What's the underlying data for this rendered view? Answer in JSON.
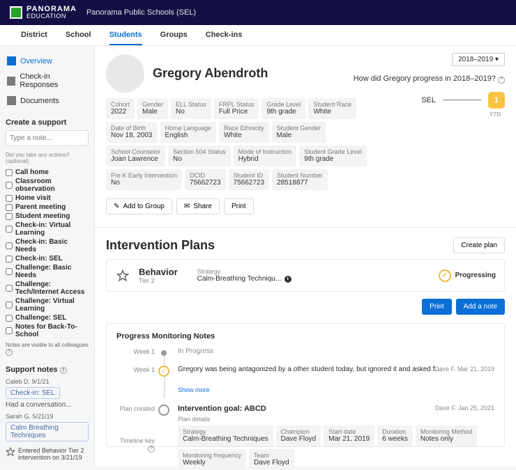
{
  "brand": {
    "name": "PANORAMA",
    "sub": "EDUCATION"
  },
  "district": "Panorama Public Schools (SEL)",
  "tabs": [
    "District",
    "School",
    "Students",
    "Groups",
    "Check-ins"
  ],
  "active_tab": "Students",
  "sidenav": {
    "overview": "Overview",
    "checkins": "Check-in Responses",
    "documents": "Documents"
  },
  "support": {
    "create_title": "Create a support",
    "placeholder": "Type a note...",
    "actions_title": "Did you take any actions?",
    "optional": "(optional)",
    "checks": [
      "Call home",
      "Classroom observation",
      "Home visit",
      "Parent meeting",
      "Student meeting",
      "Check-in: Virtual Learning",
      "Check-in: Basic Needs",
      "Check-in: SEL",
      "Challenge: Basic Needs",
      "Challenge: Tech/Internet Access",
      "Challenge: Virtual Learning",
      "Challenge: SEL",
      "Notes for Back-To-School"
    ],
    "visibility_note": "Notes are visible to all colleagues",
    "notes_title": "Support notes",
    "notes": [
      {
        "author": "Caleb D. 9/1/21",
        "tag": "Check-in: SEL",
        "text": "Had a conversation..."
      },
      {
        "author": "Sarah G. 5/21/19",
        "tag": "Calm Breathing Techniques",
        "text": ""
      }
    ],
    "star_note": "Entered Behavior Tier 2 intervention on 3/21/19"
  },
  "student": {
    "name": "Gregory Abendroth",
    "meta": [
      {
        "label": "Cohort",
        "value": "2022"
      },
      {
        "label": "Gender",
        "value": "Male"
      },
      {
        "label": "ELL Status",
        "value": "No"
      },
      {
        "label": "FRPL Status",
        "value": "Full Price"
      },
      {
        "label": "Grade Level",
        "value": "9th grade"
      },
      {
        "label": "Student Race",
        "value": "White"
      },
      {
        "label": "Date of Birth",
        "value": "Nov 18, 2003"
      },
      {
        "label": "Home Language",
        "value": "English"
      },
      {
        "label": "Race Ethnicity",
        "value": "White"
      },
      {
        "label": "Student Gender",
        "value": "Male"
      },
      {
        "label": "School Counselor",
        "value": "Joan Lawrence"
      },
      {
        "label": "Section 504 Status",
        "value": "No"
      },
      {
        "label": "Mode of Instruction",
        "value": "Hybrid"
      },
      {
        "label": "Student Grade Level",
        "value": "9th grade"
      },
      {
        "label": "Pre K Early Intervention",
        "value": "No"
      },
      {
        "label": "DCID",
        "value": "75662723"
      },
      {
        "label": "Student ID",
        "value": "75662723"
      },
      {
        "label": "Student Number",
        "value": "28518877"
      }
    ],
    "actions": {
      "add": "Add to Group",
      "share": "Share",
      "print": "Print"
    }
  },
  "progress": {
    "year": "2018–2019",
    "question": "How did Gregory progress in 2018–2019?",
    "sel_label": "SEL",
    "sel_value": "1",
    "ytd": "YTD"
  },
  "intervention": {
    "section_title": "Intervention Plans",
    "create_btn": "Create plan",
    "plan": {
      "title": "Behavior",
      "tier": "Tier 2",
      "strategy_lbl": "Strategy",
      "strategy": "Calm-Breathing Techniqu…",
      "status": "Progressing"
    },
    "print": "Print",
    "add_note": "Add a note",
    "pm_title": "Progress Monitoring Notes",
    "timeline": {
      "rows": [
        {
          "label": "Week 1",
          "type": "dot",
          "text": "In Progress"
        },
        {
          "label": "Week 1",
          "type": "check",
          "text": "Gregory was being antagonized by a other student today, but ignored it and asked f…",
          "meta": "Dave F. Mar 21, 2019"
        }
      ],
      "show_more": "Show more",
      "created_label": "Plan created",
      "goal_title": "Intervention goal:",
      "goal_value": "ABCD",
      "goal_meta": "Dave F. Jan 25, 2021",
      "details_lbl": "Plan details",
      "key_lbl": "Timeline key",
      "details": [
        {
          "label": "Strategy",
          "value": "Calm-Breathing Techniques"
        },
        {
          "label": "Champion",
          "value": "Dave Floyd"
        },
        {
          "label": "Start date",
          "value": "Mar 21, 2019"
        },
        {
          "label": "Duration",
          "value": "6 weeks"
        },
        {
          "label": "Monitoring Method",
          "value": "Notes only"
        },
        {
          "label": "Monitoring frequency",
          "value": "Weekly"
        },
        {
          "label": "Team",
          "value": "Dave Floyd"
        }
      ]
    }
  }
}
